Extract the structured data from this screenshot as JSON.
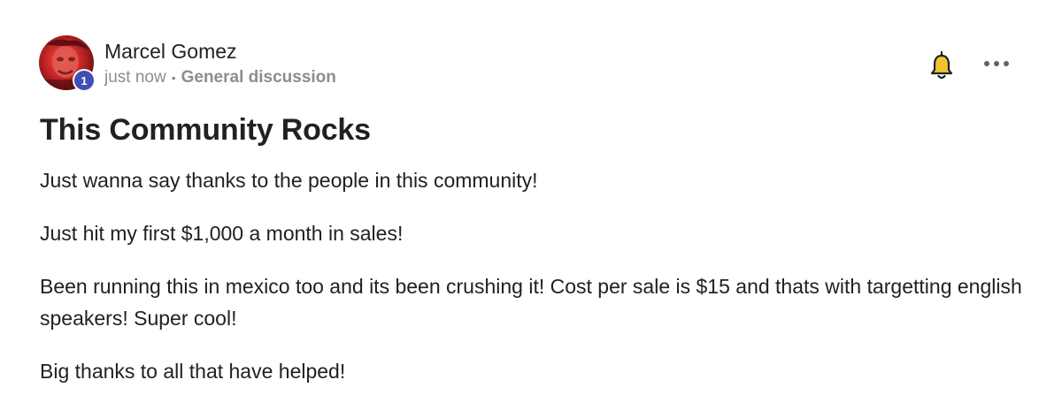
{
  "author": {
    "name": "Marcel Gomez",
    "level": "1"
  },
  "meta": {
    "time": "just now",
    "separator": "•",
    "category": "General discussion"
  },
  "post": {
    "title": "This Community Rocks",
    "paragraphs": [
      "Just wanna say thanks to the people in this community!",
      "Just hit my first $1,000 a month in sales!",
      "Been running this in mexico too and its been crushing it! Cost per sale is $15 and thats with targetting english speakers! Super cool!",
      "Big thanks to all that have helped!"
    ]
  },
  "icons": {
    "notify": "bell-icon",
    "menu": "more-options-icon"
  },
  "colors": {
    "badge": "#3f4fb5",
    "bell_fill": "#f2c230",
    "muted_text": "#8a8d91",
    "text": "#202124"
  }
}
